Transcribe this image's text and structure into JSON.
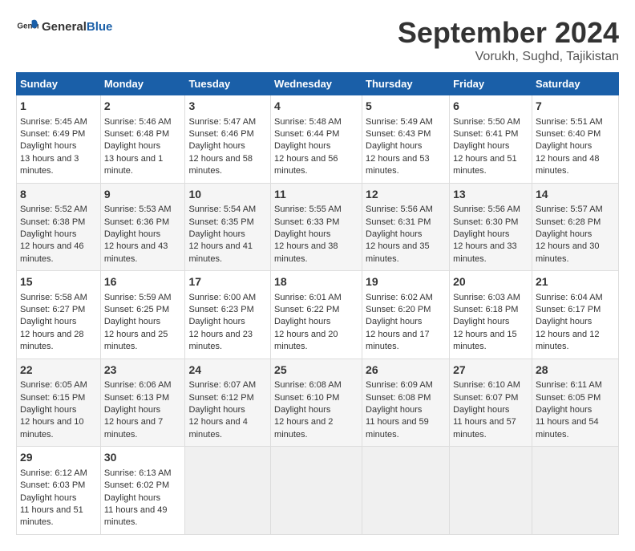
{
  "header": {
    "logo_general": "General",
    "logo_blue": "Blue",
    "month_title": "September 2024",
    "location": "Vorukh, Sughd, Tajikistan"
  },
  "weekdays": [
    "Sunday",
    "Monday",
    "Tuesday",
    "Wednesday",
    "Thursday",
    "Friday",
    "Saturday"
  ],
  "weeks": [
    [
      {
        "day": "1",
        "sunrise": "5:45 AM",
        "sunset": "6:49 PM",
        "daylight": "13 hours and 3 minutes."
      },
      {
        "day": "2",
        "sunrise": "5:46 AM",
        "sunset": "6:48 PM",
        "daylight": "13 hours and 1 minute."
      },
      {
        "day": "3",
        "sunrise": "5:47 AM",
        "sunset": "6:46 PM",
        "daylight": "12 hours and 58 minutes."
      },
      {
        "day": "4",
        "sunrise": "5:48 AM",
        "sunset": "6:44 PM",
        "daylight": "12 hours and 56 minutes."
      },
      {
        "day": "5",
        "sunrise": "5:49 AM",
        "sunset": "6:43 PM",
        "daylight": "12 hours and 53 minutes."
      },
      {
        "day": "6",
        "sunrise": "5:50 AM",
        "sunset": "6:41 PM",
        "daylight": "12 hours and 51 minutes."
      },
      {
        "day": "7",
        "sunrise": "5:51 AM",
        "sunset": "6:40 PM",
        "daylight": "12 hours and 48 minutes."
      }
    ],
    [
      {
        "day": "8",
        "sunrise": "5:52 AM",
        "sunset": "6:38 PM",
        "daylight": "12 hours and 46 minutes."
      },
      {
        "day": "9",
        "sunrise": "5:53 AM",
        "sunset": "6:36 PM",
        "daylight": "12 hours and 43 minutes."
      },
      {
        "day": "10",
        "sunrise": "5:54 AM",
        "sunset": "6:35 PM",
        "daylight": "12 hours and 41 minutes."
      },
      {
        "day": "11",
        "sunrise": "5:55 AM",
        "sunset": "6:33 PM",
        "daylight": "12 hours and 38 minutes."
      },
      {
        "day": "12",
        "sunrise": "5:56 AM",
        "sunset": "6:31 PM",
        "daylight": "12 hours and 35 minutes."
      },
      {
        "day": "13",
        "sunrise": "5:56 AM",
        "sunset": "6:30 PM",
        "daylight": "12 hours and 33 minutes."
      },
      {
        "day": "14",
        "sunrise": "5:57 AM",
        "sunset": "6:28 PM",
        "daylight": "12 hours and 30 minutes."
      }
    ],
    [
      {
        "day": "15",
        "sunrise": "5:58 AM",
        "sunset": "6:27 PM",
        "daylight": "12 hours and 28 minutes."
      },
      {
        "day": "16",
        "sunrise": "5:59 AM",
        "sunset": "6:25 PM",
        "daylight": "12 hours and 25 minutes."
      },
      {
        "day": "17",
        "sunrise": "6:00 AM",
        "sunset": "6:23 PM",
        "daylight": "12 hours and 23 minutes."
      },
      {
        "day": "18",
        "sunrise": "6:01 AM",
        "sunset": "6:22 PM",
        "daylight": "12 hours and 20 minutes."
      },
      {
        "day": "19",
        "sunrise": "6:02 AM",
        "sunset": "6:20 PM",
        "daylight": "12 hours and 17 minutes."
      },
      {
        "day": "20",
        "sunrise": "6:03 AM",
        "sunset": "6:18 PM",
        "daylight": "12 hours and 15 minutes."
      },
      {
        "day": "21",
        "sunrise": "6:04 AM",
        "sunset": "6:17 PM",
        "daylight": "12 hours and 12 minutes."
      }
    ],
    [
      {
        "day": "22",
        "sunrise": "6:05 AM",
        "sunset": "6:15 PM",
        "daylight": "12 hours and 10 minutes."
      },
      {
        "day": "23",
        "sunrise": "6:06 AM",
        "sunset": "6:13 PM",
        "daylight": "12 hours and 7 minutes."
      },
      {
        "day": "24",
        "sunrise": "6:07 AM",
        "sunset": "6:12 PM",
        "daylight": "12 hours and 4 minutes."
      },
      {
        "day": "25",
        "sunrise": "6:08 AM",
        "sunset": "6:10 PM",
        "daylight": "12 hours and 2 minutes."
      },
      {
        "day": "26",
        "sunrise": "6:09 AM",
        "sunset": "6:08 PM",
        "daylight": "11 hours and 59 minutes."
      },
      {
        "day": "27",
        "sunrise": "6:10 AM",
        "sunset": "6:07 PM",
        "daylight": "11 hours and 57 minutes."
      },
      {
        "day": "28",
        "sunrise": "6:11 AM",
        "sunset": "6:05 PM",
        "daylight": "11 hours and 54 minutes."
      }
    ],
    [
      {
        "day": "29",
        "sunrise": "6:12 AM",
        "sunset": "6:03 PM",
        "daylight": "11 hours and 51 minutes."
      },
      {
        "day": "30",
        "sunrise": "6:13 AM",
        "sunset": "6:02 PM",
        "daylight": "11 hours and 49 minutes."
      },
      null,
      null,
      null,
      null,
      null
    ]
  ]
}
